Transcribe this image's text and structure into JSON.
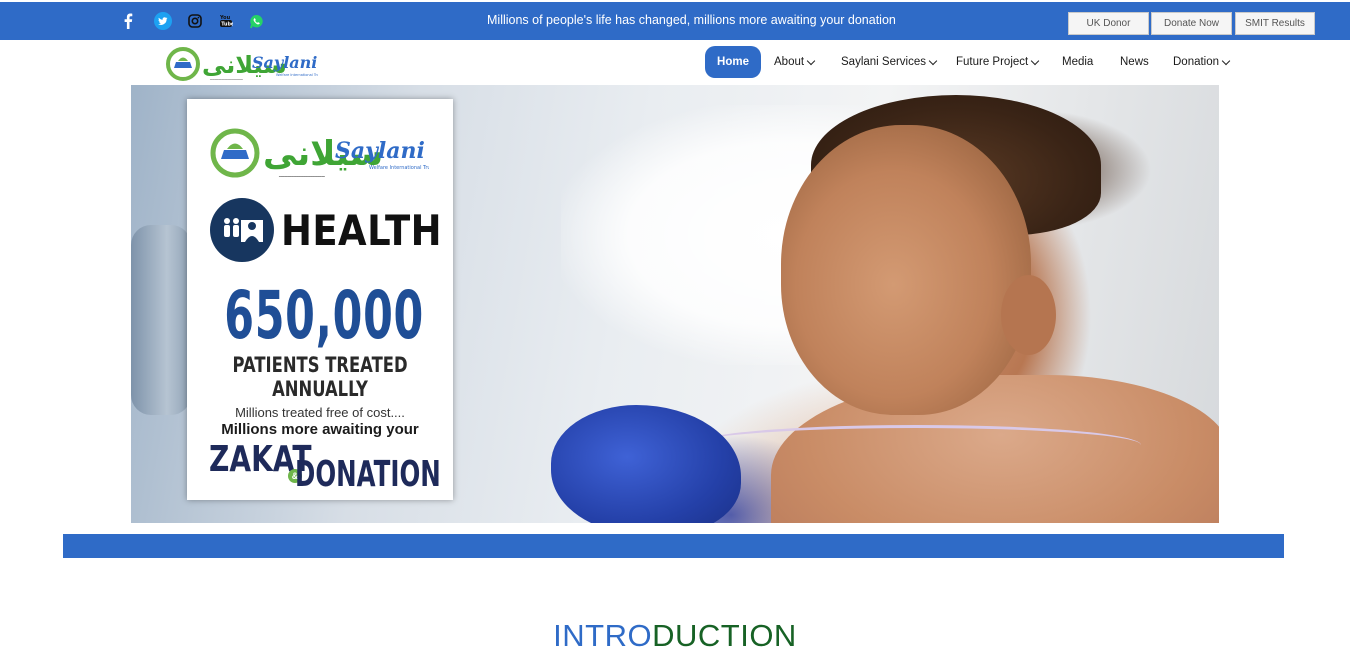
{
  "topbar": {
    "social": [
      {
        "icon": "facebook-icon"
      },
      {
        "icon": "twitter-icon"
      },
      {
        "icon": "instagram-icon"
      },
      {
        "icon": "youtube-icon"
      },
      {
        "icon": "whatsapp-icon"
      }
    ],
    "tagline": "Millions of people's life has changed, millions more awaiting your donation",
    "buttons": [
      "UK Donor",
      "Donate Now",
      "SMIT Results"
    ]
  },
  "nav": {
    "items": [
      {
        "label": "Home",
        "active": true
      },
      {
        "label": "About",
        "dropdown": true
      },
      {
        "label": "Saylani Services",
        "dropdown": true
      },
      {
        "label": "Future Project",
        "dropdown": true
      },
      {
        "label": "Media"
      },
      {
        "label": "News"
      },
      {
        "label": "Donation",
        "dropdown": true
      }
    ]
  },
  "hero": {
    "card": {
      "heading": "HEALTH",
      "number": "650,000",
      "subheading": "PATIENTS TREATED ANNUALLY",
      "line1": "Millions treated free of cost....",
      "line2": "Millions more awaiting your",
      "zakat": "ZAKAT",
      "and": "&",
      "donation": "DONATION"
    }
  },
  "section": {
    "title_part1": "INTRO",
    "title_part2": "DUCTION"
  },
  "colors": {
    "primary_blue": "#2f6bc7",
    "intro_green": "#176225",
    "number_blue": "#1f4e96"
  }
}
